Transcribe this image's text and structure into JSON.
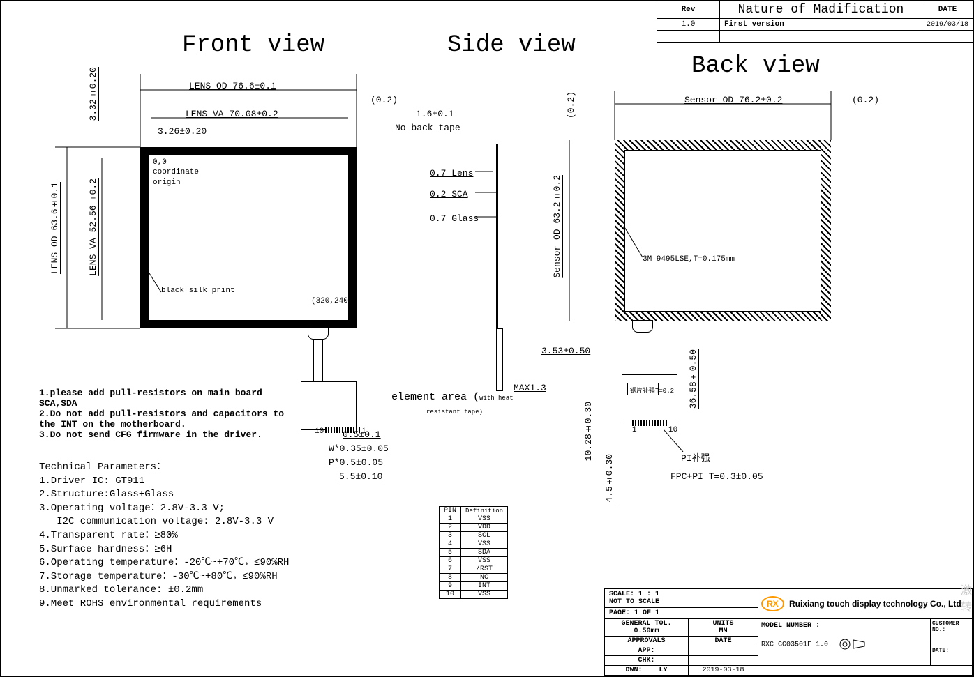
{
  "rev_table": {
    "h1": "Rev",
    "h2": "Nature of Madification",
    "h3": "DATE",
    "r1c1": "1.0",
    "r1c2": "First version",
    "r1c3": "2019/03/18"
  },
  "views": {
    "front": "Front view",
    "side": "Side view",
    "back": "Back view"
  },
  "front": {
    "lens_od": "LENS OD 76.6±0.1",
    "lens_va": "LENS VA 70.08±0.2",
    "d326": "3.26±0.20",
    "lens_od_v": "LENS OD 63.6±0.1",
    "lens_va_v": "LENS VA 52.56±0.2",
    "d332": "3.32±0.20",
    "origin": "0,0\ncoordinate\norigin",
    "silk": "black silk print",
    "res": "(320,240)",
    "p02": "(0.2)"
  },
  "side": {
    "t16": "1.6±0.1",
    "noback": "No back tape",
    "lens": "0.7 Lens",
    "sca": "0.2 SCA",
    "glass": "0.7 Glass",
    "elem": "element area (",
    "elem2": "with heat",
    "elem3": "resistant tape)",
    "d05": "0.5±0.1",
    "w035": "W*0.35±0.05",
    "p05": "P*0.5±0.05",
    "d55": "5.5±0.10",
    "pin10": "10",
    "pin1": "1",
    "max13": "MAX1.3"
  },
  "back": {
    "sensor_od": "Sensor OD 76.2±0.2",
    "p02": "(0.2)",
    "sensor_od_v": "Sensor OD 63.2±0.2",
    "p02v": "(0.2)",
    "tape3m": "3M 9495LSE,T=0.175mm",
    "d353": "3.53±0.50",
    "d3658": "36.58±0.50",
    "steel": "钢片补强T=0.2",
    "d1028": "10.28±0.30",
    "d45": "4.5±0.30",
    "pi": "PI补强",
    "fpcpi": "FPC+PI T=0.3±0.05",
    "pin1": "1",
    "pin10": "10"
  },
  "notes": {
    "n1": "1.please add pull-resistors on main board SCA,SDA",
    "n2": "2.Do not add pull-resistors and capacitors to the INT on the motherboard.",
    "n3": "3.Do not send CFG firmware in the driver."
  },
  "tech": {
    "title": "Technical Parameters：",
    "p1": "1.Driver IC: GT911",
    "p2": "2.Structure:Glass+Glass",
    "p3": "3.Operating voltage：2.8V-3.3 V;",
    "p3b": "   I2C communication voltage: 2.8V-3.3 V",
    "p4": "4.Transparent rate：≥80%",
    "p5": "5.Surface hardness：≥6H",
    "p6": "6.Operating temperature：-20℃~+70℃，≤90%RH",
    "p7": "7.Storage temperature：-30℃~+80℃，≤90%RH",
    "p8": "8.Unmarked tolerance: ±0.2mm",
    "p9": "9.Meet ROHS environmental requirements"
  },
  "pins": {
    "h1": "PIN",
    "h2": "Definition",
    "p1": "VSS",
    "p2": "VDD",
    "p3": "SCL",
    "p4": "VSS",
    "p5": "SDA",
    "p6": "VSS",
    "p7": "/RST",
    "p8": "NC",
    "p9": "INT",
    "p10": "VSS"
  },
  "tb": {
    "scale": "SCALE: 1 : 1",
    "nts": "NOT TO SCALE",
    "page": "PAGE:  1 OF 1",
    "gtol": "GENERAL TOL.",
    "gtolv": "0.50mm",
    "units": "UNITS",
    "unitsv": "MM",
    "app": "APPROVALS",
    "date": "DATE",
    "appl": "APP:",
    "chk": "CHK:",
    "dwn": "DWN:",
    "dwnv": "LY",
    "dwnd": "2019-03-18",
    "company": "Ruixiang touch display technology Co., Ltd",
    "model": "MODEL NUMBER :",
    "modelv": "RXC-GG03501F-1.0",
    "cust": "CUSTOMER NO.:",
    "datef": "DATE:",
    "rx": "RX"
  }
}
